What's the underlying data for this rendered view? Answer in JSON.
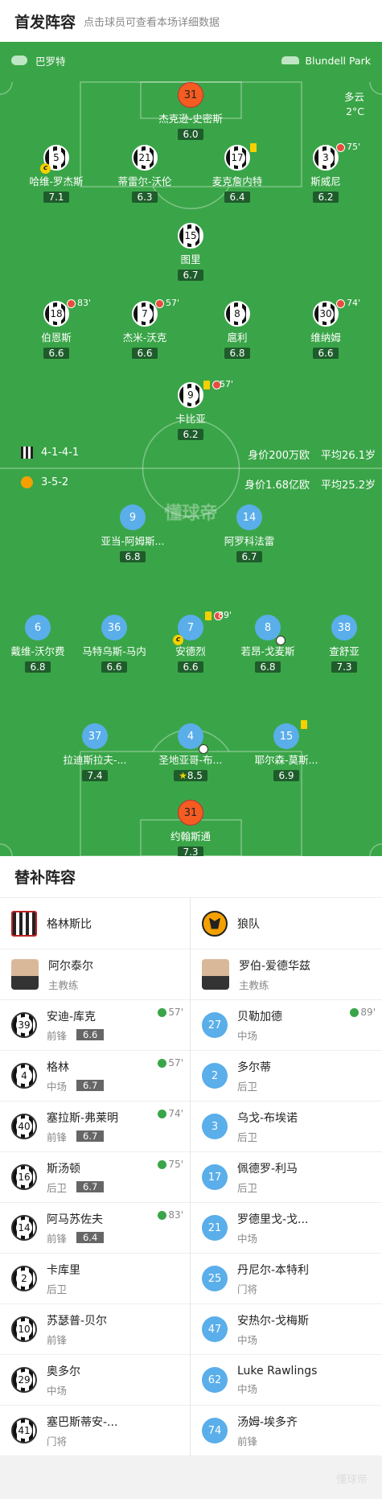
{
  "header": {
    "title": "首发阵容",
    "subtitle": "点击球员可查看本场详细数据"
  },
  "pitch": {
    "home_team": "巴罗特",
    "venue": "Blundell Park",
    "weather": "多云",
    "temp": "2°C",
    "home_formation": "4-1-4-1",
    "home_value": "身价200万欧",
    "home_age": "平均26.1岁",
    "away_formation": "3-5-2",
    "away_value": "身价1.68亿欧",
    "away_age": "平均25.2岁",
    "watermark": "懂球帝"
  },
  "home_players": [
    {
      "num": "31",
      "name": "杰克逊-史密斯",
      "rating": "6.0",
      "gk": true
    },
    {
      "num": "5",
      "name": "哈维-罗杰斯",
      "rating": "7.1"
    },
    {
      "num": "21",
      "name": "蒂雷尔-沃伦",
      "rating": "6.3"
    },
    {
      "num": "17",
      "name": "麦克詹内特",
      "rating": "6.4"
    },
    {
      "num": "3",
      "name": "斯威尼",
      "rating": "6.2",
      "sub": "75'"
    },
    {
      "num": "15",
      "name": "图里",
      "rating": "6.7"
    },
    {
      "num": "18",
      "name": "伯恩斯",
      "rating": "6.6",
      "sub": "83'"
    },
    {
      "num": "7",
      "name": "杰米-沃克",
      "rating": "6.6",
      "sub": "57'"
    },
    {
      "num": "8",
      "name": "扈利",
      "rating": "6.8"
    },
    {
      "num": "30",
      "name": "维纳姆",
      "rating": "6.6",
      "sub": "74'"
    },
    {
      "num": "9",
      "name": "卡比亚",
      "rating": "6.2",
      "sub": "57'"
    }
  ],
  "away_players": [
    {
      "num": "9",
      "name": "亚当-阿姆斯...",
      "rating": "6.8"
    },
    {
      "num": "14",
      "name": "阿罗科法雷",
      "rating": "6.7"
    },
    {
      "num": "6",
      "name": "戴维-沃尔费",
      "rating": "6.8"
    },
    {
      "num": "36",
      "name": "马特乌斯-马内",
      "rating": "6.6"
    },
    {
      "num": "7",
      "name": "安德烈",
      "rating": "6.6",
      "sub": "89'"
    },
    {
      "num": "8",
      "name": "若昂-戈麦斯",
      "rating": "6.8"
    },
    {
      "num": "38",
      "name": "查舒亚",
      "rating": "7.3"
    },
    {
      "num": "37",
      "name": "拉迪斯拉夫-...",
      "rating": "7.4"
    },
    {
      "num": "4",
      "name": "圣地亚哥-布...",
      "rating": "8.5"
    },
    {
      "num": "15",
      "name": "耶尔森-莫斯...",
      "rating": "6.9"
    },
    {
      "num": "31",
      "name": "约翰斯通",
      "rating": "7.3",
      "gk": true
    }
  ],
  "subs": {
    "title": "替补阵容",
    "home": {
      "team": "格林斯比",
      "coach": "阿尔泰尔",
      "coach_role": "主教练",
      "players": [
        {
          "num": "39",
          "name": "安迪-库克",
          "pos": "前锋",
          "rating": "6.6",
          "in": "57'"
        },
        {
          "num": "4",
          "name": "格林",
          "pos": "中场",
          "rating": "6.7",
          "in": "57'"
        },
        {
          "num": "40",
          "name": "塞拉斯-弗莱明",
          "pos": "前锋",
          "rating": "6.7",
          "in": "74'"
        },
        {
          "num": "16",
          "name": "斯汤顿",
          "pos": "后卫",
          "rating": "6.7",
          "in": "75'"
        },
        {
          "num": "14",
          "name": "阿马苏佐夫",
          "pos": "前锋",
          "rating": "6.4",
          "in": "83'"
        },
        {
          "num": "2",
          "name": "卡库里",
          "pos": "后卫"
        },
        {
          "num": "10",
          "name": "苏瑟普-贝尔",
          "pos": "前锋"
        },
        {
          "num": "29",
          "name": "奥多尔",
          "pos": "中场"
        },
        {
          "num": "41",
          "name": "塞巴斯蒂安-...",
          "pos": "门将"
        }
      ]
    },
    "away": {
      "team": "狼队",
      "coach": "罗伯-爱德华兹",
      "coach_role": "主教练",
      "players": [
        {
          "num": "27",
          "name": "贝勒加德",
          "pos": "中场",
          "in": "89'"
        },
        {
          "num": "2",
          "name": "多尔蒂",
          "pos": "后卫"
        },
        {
          "num": "3",
          "name": "乌戈-布埃诺",
          "pos": "后卫"
        },
        {
          "num": "17",
          "name": "佩德罗-利马",
          "pos": "后卫"
        },
        {
          "num": "21",
          "name": "罗德里戈-戈...",
          "pos": "中场"
        },
        {
          "num": "25",
          "name": "丹尼尔-本特利",
          "pos": "门将"
        },
        {
          "num": "47",
          "name": "安热尔-戈梅斯",
          "pos": "中场"
        },
        {
          "num": "62",
          "name": "Luke Rawlings",
          "pos": "中场"
        },
        {
          "num": "74",
          "name": "汤姆-埃多齐",
          "pos": "前锋"
        }
      ]
    }
  },
  "footer": {
    "watermark": "懂球帝"
  }
}
